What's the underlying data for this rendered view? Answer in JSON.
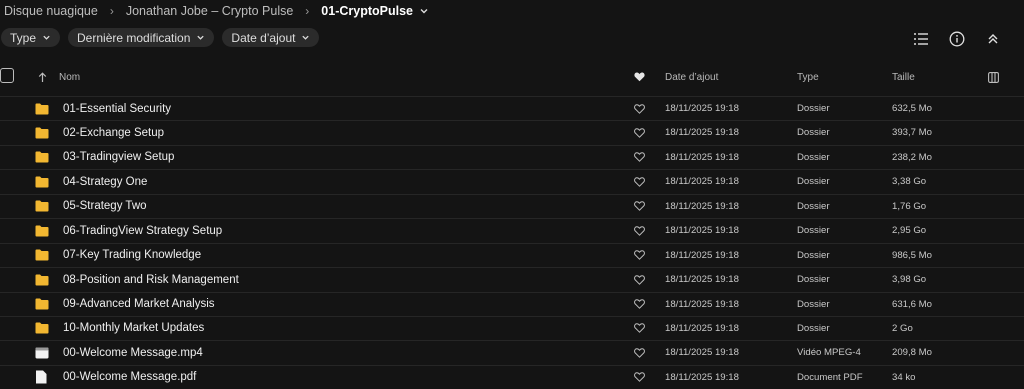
{
  "breadcrumb": {
    "items": [
      "Disque nuagique",
      "Jonathan Jobe – Crypto Pulse"
    ],
    "current": "01-CryptoPulse"
  },
  "filters": [
    "Type",
    "Dernière modification",
    "Date d’ajout"
  ],
  "toolbar_icons": [
    "list-view-icon",
    "info-icon",
    "collapse-icon"
  ],
  "columns": {
    "name": "Nom",
    "date_added": "Date d’ajout",
    "type": "Type",
    "size": "Taille"
  },
  "files": [
    {
      "name": "01-Essential Security",
      "date": "18/11/2025 19:18",
      "type": "Dossier",
      "size": "632,5 Mo",
      "icon": "folder"
    },
    {
      "name": "02-Exchange Setup",
      "date": "18/11/2025 19:18",
      "type": "Dossier",
      "size": "393,7 Mo",
      "icon": "folder"
    },
    {
      "name": "03-Tradingview Setup",
      "date": "18/11/2025 19:18",
      "type": "Dossier",
      "size": "238,2 Mo",
      "icon": "folder"
    },
    {
      "name": "04-Strategy One",
      "date": "18/11/2025 19:18",
      "type": "Dossier",
      "size": "3,38 Go",
      "icon": "folder"
    },
    {
      "name": "05-Strategy Two",
      "date": "18/11/2025 19:18",
      "type": "Dossier",
      "size": "1,76 Go",
      "icon": "folder"
    },
    {
      "name": "06-TradingView Strategy Setup",
      "date": "18/11/2025 19:18",
      "type": "Dossier",
      "size": "2,95 Go",
      "icon": "folder"
    },
    {
      "name": "07-Key Trading Knowledge",
      "date": "18/11/2025 19:18",
      "type": "Dossier",
      "size": "986,5 Mo",
      "icon": "folder"
    },
    {
      "name": "08-Position and Risk Management",
      "date": "18/11/2025 19:18",
      "type": "Dossier",
      "size": "3,98 Go",
      "icon": "folder"
    },
    {
      "name": "09-Advanced Market Analysis",
      "date": "18/11/2025 19:18",
      "type": "Dossier",
      "size": "631,6 Mo",
      "icon": "folder"
    },
    {
      "name": "10-Monthly Market Updates",
      "date": "18/11/2025 19:18",
      "type": "Dossier",
      "size": "2 Go",
      "icon": "folder"
    },
    {
      "name": "00-Welcome Message.mp4",
      "date": "18/11/2025 19:18",
      "type": "Vidéo MPEG-4",
      "size": "209,8 Mo",
      "icon": "video"
    },
    {
      "name": "00-Welcome Message.pdf",
      "date": "18/11/2025 19:18",
      "type": "Document PDF",
      "size": "34 ko",
      "icon": "pdf"
    }
  ],
  "colors": {
    "background": "#141414",
    "folder": "#f2b731",
    "chip": "#2b2b2b"
  }
}
